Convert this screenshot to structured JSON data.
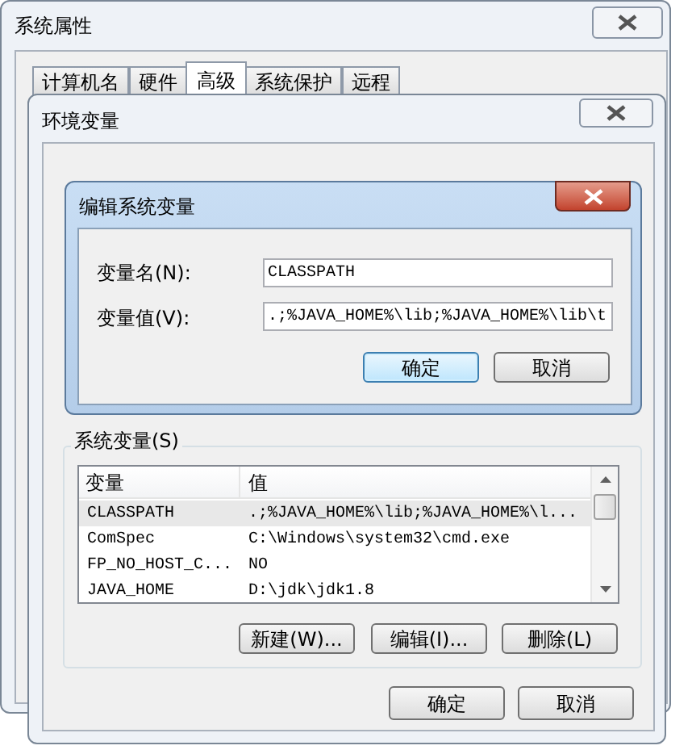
{
  "system_properties": {
    "title": "系统属性",
    "tabs": [
      {
        "label": "计算机名",
        "selected": false
      },
      {
        "label": "硬件",
        "selected": false
      },
      {
        "label": "高级",
        "selected": true
      },
      {
        "label": "系统保护",
        "selected": false
      },
      {
        "label": "远程",
        "selected": false
      }
    ]
  },
  "environment_variables": {
    "title": "环境变量",
    "system_variables": {
      "label": "系统变量(S)",
      "columns": [
        "变量",
        "值"
      ],
      "rows": [
        {
          "variable": "CLASSPATH",
          "value": ".;%JAVA_HOME%\\lib;%JAVA_HOME%\\l...",
          "selected": true
        },
        {
          "variable": "ComSpec",
          "value": "C:\\Windows\\system32\\cmd.exe",
          "selected": false
        },
        {
          "variable": "FP_NO_HOST_C...",
          "value": "NO",
          "selected": false
        },
        {
          "variable": "JAVA_HOME",
          "value": "D:\\jdk\\jdk1.8",
          "selected": false
        }
      ],
      "buttons": [
        "新建(W)...",
        "编辑(I)...",
        "删除(L)"
      ]
    },
    "buttons": [
      "确定",
      "取消"
    ]
  },
  "edit_dialog": {
    "title": "编辑系统变量",
    "fields": [
      {
        "label": "变量名(N):",
        "value": "CLASSPATH"
      },
      {
        "label": "变量值(V):",
        "value": ".;%JAVA_HOME%\\lib;%JAVA_HOME%\\lib\\t"
      }
    ],
    "buttons": [
      {
        "label": "确定",
        "focused": true
      },
      {
        "label": "取消",
        "focused": false
      }
    ]
  }
}
